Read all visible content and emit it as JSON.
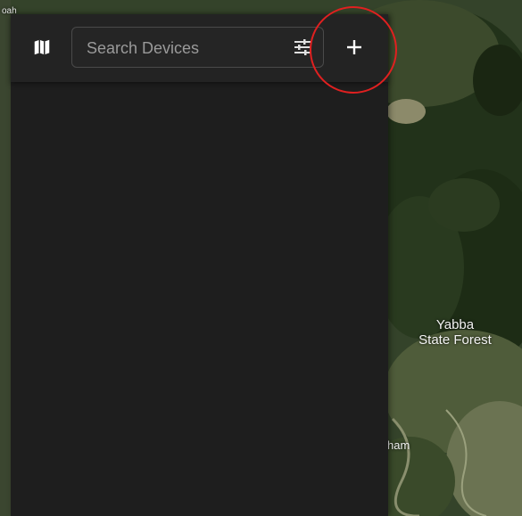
{
  "map": {
    "labels": {
      "forest": "Yabba\nState Forest",
      "place": "ham",
      "corner": "oah"
    }
  },
  "toolbar": {
    "map_icon": "map-icon",
    "search": {
      "placeholder": "Search Devices",
      "value": ""
    },
    "filter_icon": "tune-icon",
    "add_icon": "plus-icon"
  },
  "colors": {
    "panel": "#1e1e1e",
    "topbar": "#232323",
    "highlight": "#e02020"
  }
}
